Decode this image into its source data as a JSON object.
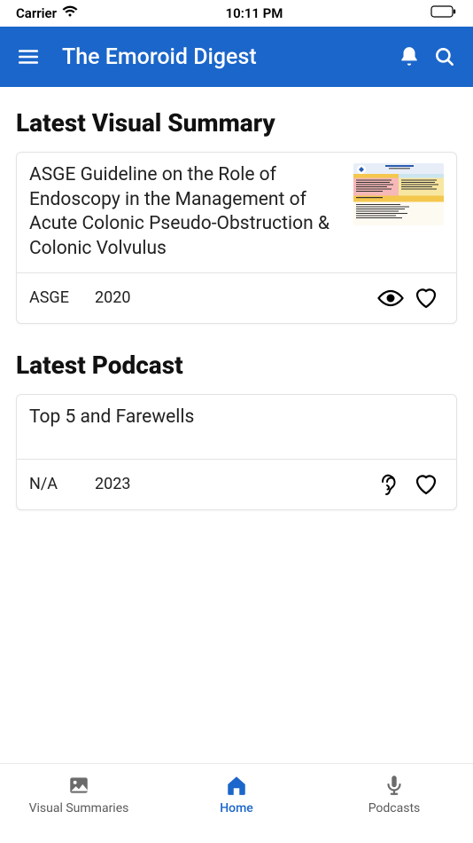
{
  "status_bar": {
    "carrier": "Carrier",
    "time": "10:11 PM"
  },
  "app_bar": {
    "title": "The Emoroid Digest"
  },
  "sections": {
    "visual_summary": {
      "heading": "Latest Visual Summary",
      "card": {
        "title": "ASGE Guideline on the Role of Endoscopy in the Management of Acute Colonic Pseudo-Obstruction & Colonic Volvulus",
        "org": "ASGE",
        "year": "2020"
      }
    },
    "podcast": {
      "heading": "Latest Podcast",
      "card": {
        "title": "Top 5 and Farewells",
        "org": "N/A",
        "year": "2023"
      }
    }
  },
  "bottom_nav": {
    "visual_summaries": "Visual Summaries",
    "home": "Home",
    "podcasts": "Podcasts"
  }
}
